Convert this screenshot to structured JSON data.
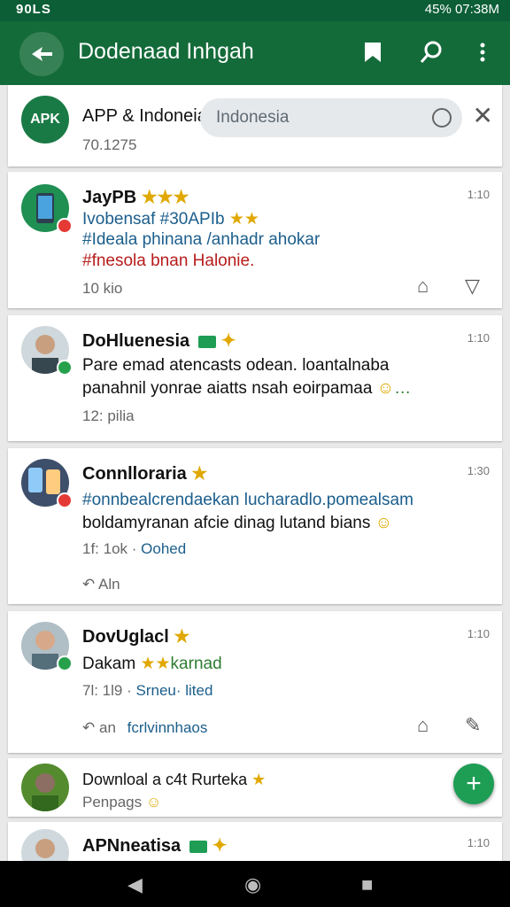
{
  "status": {
    "left": "90LS",
    "right": "45% 07:38M"
  },
  "appbar": {
    "title": "Dodenaad Inhgah"
  },
  "search": {
    "value": "Indonesia"
  },
  "posts": [
    {
      "name": "APP & Indoneia",
      "meta": "70.1275"
    },
    {
      "name": "JayPB",
      "time": "1:10",
      "line1": "Ivobensaf #30APIb",
      "line2": "#Ideala phinana /anhadr ahokar",
      "line3": "#fnesola bnan Halonie.",
      "meta": "10 kio"
    },
    {
      "name": "DoHluenesia",
      "time": "1:10",
      "line1": "Pare emad atencasts odean. loantalnaba",
      "line2": "panahnil yonrae aiatts nsah eoirpamaa",
      "line2_tail": "…",
      "meta": "12: pilia"
    },
    {
      "name": "Connlloraria",
      "time": "1:30",
      "line1": "#onnbealcrendaekan lucharadlo.pomealsam",
      "line2": "boldamyranan afcie dinag lutand bians",
      "meta_a": "1f: 1ok ·",
      "meta_b": "Oohed",
      "action": "Aln"
    },
    {
      "name": "DovUglacl",
      "time": "1:10",
      "line1": "Dakam",
      "line1_b": "karnad",
      "meta_a": "7l: 1l9 ·",
      "meta_b": "Srneu· lited",
      "action_a": "an",
      "action_b": "fcrlvinnhaos"
    },
    {
      "name": "Downloal a c4t Rurteka",
      "line1": "Penpags"
    },
    {
      "name": "APNneatisa",
      "time": "1:10"
    }
  ],
  "nav": {
    "back": "◀",
    "home": "◉",
    "recent": "■"
  }
}
